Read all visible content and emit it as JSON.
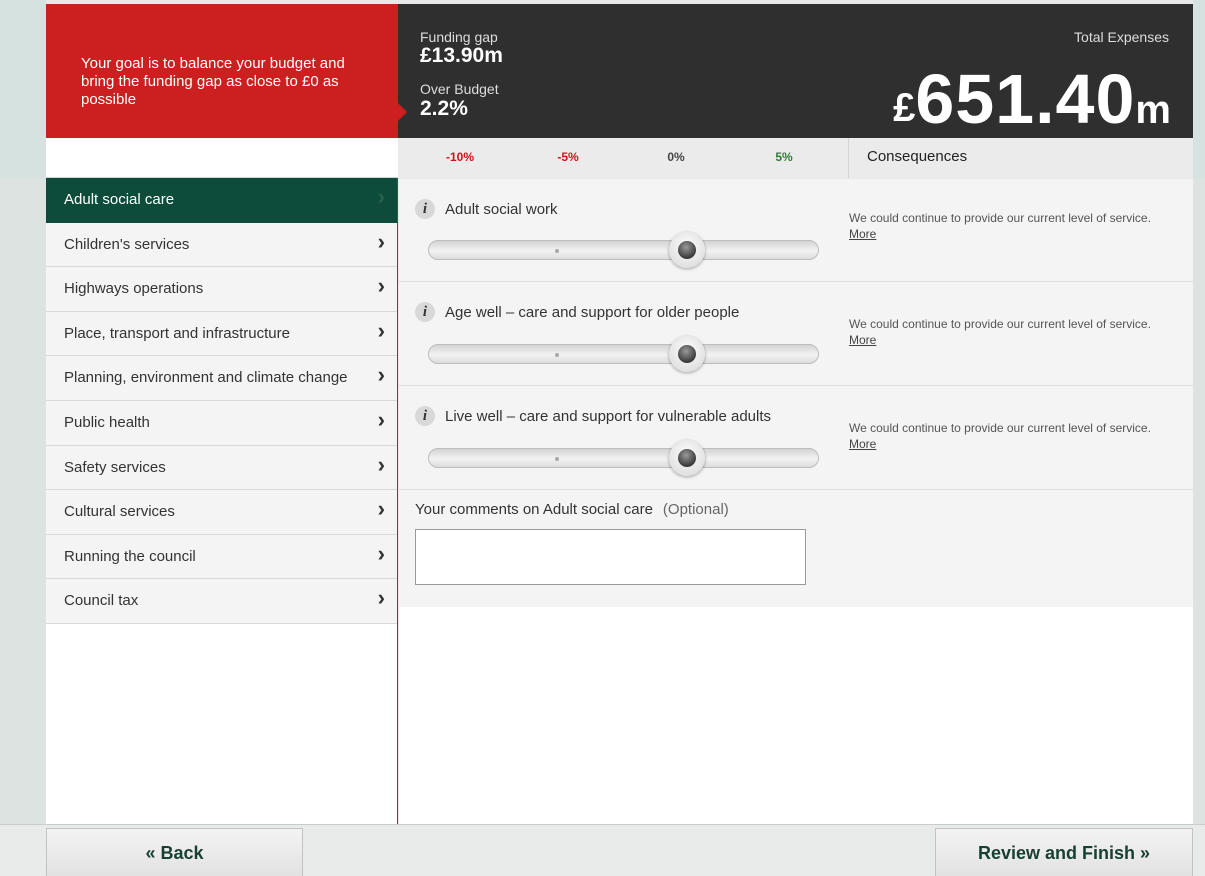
{
  "header": {
    "goal_text": "Your goal is to balance your budget and bring the funding gap as close to £0 as possible",
    "funding_gap_label": "Funding gap",
    "funding_gap_value": "£13.90m",
    "over_budget_label": "Over Budget",
    "over_budget_value": "2.2%",
    "total_label": "Total Expenses",
    "total_currency": "£",
    "total_number": "651.40",
    "total_unit": "m"
  },
  "scale": {
    "labels": [
      "-10%",
      "-5%",
      "0%",
      "5%"
    ],
    "colors": [
      "#d0121b",
      "#d0121b",
      "#444444",
      "#2e7d32"
    ],
    "consequences_heading": "Consequences"
  },
  "sidebar": {
    "items": [
      {
        "label": "Adult social care",
        "active": true
      },
      {
        "label": "Children's services"
      },
      {
        "label": "Highways operations"
      },
      {
        "label": "Place, transport and infrastructure"
      },
      {
        "label": "Planning, environment and climate change"
      },
      {
        "label": "Public health"
      },
      {
        "label": "Safety services"
      },
      {
        "label": "Cultural services"
      },
      {
        "label": "Running the council"
      },
      {
        "label": "Council tax"
      }
    ]
  },
  "services": [
    {
      "title": "Adult social work",
      "slider_value_pct": 0,
      "consequence": "We could continue to provide our current level of service.",
      "more": "More"
    },
    {
      "title": "Age well – care and support for older people",
      "slider_value_pct": 0,
      "consequence": "We could continue to provide our current level of service.",
      "more": "More"
    },
    {
      "title": "Live well – care and support for vulnerable adults",
      "slider_value_pct": 0,
      "consequence": "We could continue to provide our current level of service.",
      "more": "More"
    }
  ],
  "comments": {
    "label": "Your comments on Adult social care",
    "optional": "(Optional)",
    "value": ""
  },
  "footer": {
    "back_label": "« Back",
    "finish_label": "Review and Finish »"
  },
  "colors": {
    "goal_red": "#cc1f1f",
    "header_dark": "#2f2f2f",
    "active_green": "#0d4c3a"
  }
}
